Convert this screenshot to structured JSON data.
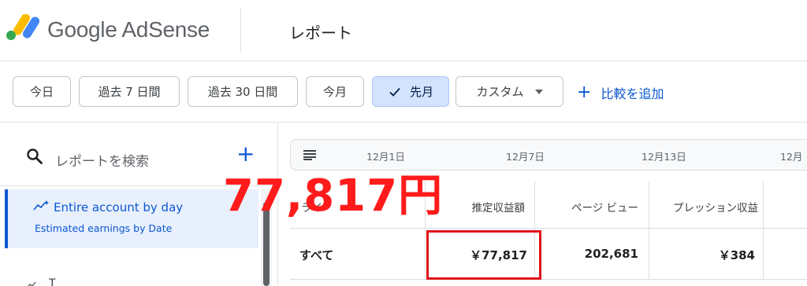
{
  "app": {
    "title": "Google AdSense",
    "page_title": "レポート"
  },
  "filters": {
    "chips": [
      {
        "label": "今日",
        "selected": false
      },
      {
        "label": "過去 7 日間",
        "selected": false
      },
      {
        "label": "過去 30 日間",
        "selected": false
      },
      {
        "label": "今月",
        "selected": false
      },
      {
        "label": "先月",
        "selected": true
      },
      {
        "label": "カスタム",
        "selected": false
      }
    ],
    "add_compare": "比較を追加"
  },
  "sidebar": {
    "search_placeholder": "レポートを検索",
    "add_icon": "plus-icon",
    "selected_report": {
      "name": "Entire account by day",
      "subtitle": "Estimated earnings by Date"
    },
    "next_item_partial": "T"
  },
  "timeline": {
    "ticks": [
      "12月1日",
      "12月7日",
      "12月13日",
      "12月"
    ]
  },
  "table": {
    "headers": [
      "ライ",
      "推定収益額",
      "ページ ビュー",
      "プレッション収益"
    ],
    "rows": [
      {
        "name": "すべて",
        "earnings": "￥77,817",
        "page_views": "202,681",
        "impression_revenue": "￥384"
      }
    ]
  },
  "annotation": {
    "amount": "77,817円"
  },
  "colors": {
    "accent": "#0b57d0",
    "selected_chip_bg": "#d3e3fd",
    "annotation_red": "#ff1b1b"
  }
}
